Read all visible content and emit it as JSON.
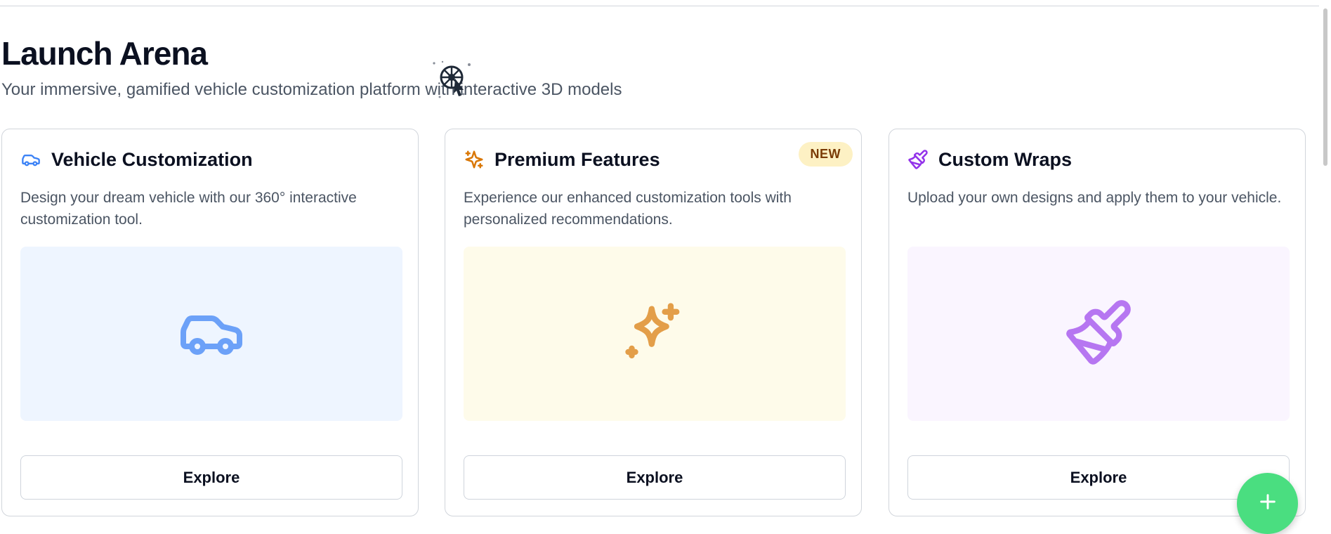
{
  "header": {
    "title": "Launch Arena",
    "subtitle": "Your immersive, gamified vehicle customization platform with interactive 3D models"
  },
  "cards": [
    {
      "title": "Vehicle Customization",
      "description": "Design your dream vehicle with our 360° interactive customization tool.",
      "button_label": "Explore",
      "icon": "car-icon",
      "accent": "#3b82f6",
      "preview_bg": "#eef5ff"
    },
    {
      "title": "Premium Features",
      "description": "Experience our enhanced customization tools with personalized recommendations.",
      "button_label": "Explore",
      "badge": "NEW",
      "icon": "sparkles-icon",
      "accent": "#d97706",
      "preview_bg": "#fefbea"
    },
    {
      "title": "Custom Wraps",
      "description": "Upload your own designs and apply them to your vehicle.",
      "button_label": "Explore",
      "icon": "paintbrush-icon",
      "accent": "#9333ea",
      "preview_bg": "#faf5ff"
    }
  ],
  "fab": {
    "icon": "plus-icon",
    "color": "#4ade80"
  }
}
